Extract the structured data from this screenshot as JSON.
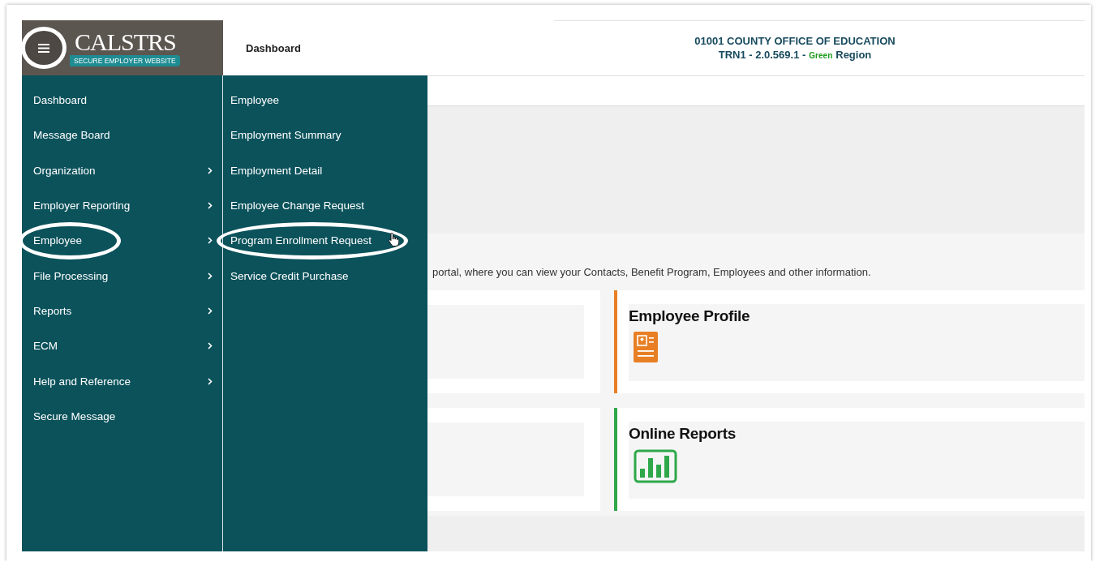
{
  "header": {
    "logo": {
      "name": "CALSTRS",
      "tagline": "SECURE EMPLOYER WEBSITE"
    },
    "menu_button": {
      "highlighted": true
    },
    "page_title": "Dashboard",
    "organization": "01001 COUNTY OFFICE OF EDUCATION",
    "environment": {
      "prefix": "TRN1 - 2.0.569.1 -",
      "region_color_name": "Green",
      "suffix": "Region"
    }
  },
  "menu": {
    "items": [
      {
        "label": "Dashboard",
        "has_submenu": false,
        "highlighted": false
      },
      {
        "label": "Message Board",
        "has_submenu": false,
        "highlighted": false
      },
      {
        "label": "Organization",
        "has_submenu": true,
        "highlighted": false
      },
      {
        "label": "Employer Reporting",
        "has_submenu": true,
        "highlighted": false
      },
      {
        "label": "Employee",
        "has_submenu": true,
        "highlighted": true
      },
      {
        "label": "File Processing",
        "has_submenu": true,
        "highlighted": false
      },
      {
        "label": "Reports",
        "has_submenu": true,
        "highlighted": false
      },
      {
        "label": "ECM",
        "has_submenu": true,
        "highlighted": false
      },
      {
        "label": "Help and Reference",
        "has_submenu": true,
        "highlighted": false
      },
      {
        "label": "Secure Message",
        "has_submenu": false,
        "highlighted": false
      }
    ],
    "submenu": [
      {
        "label": "Employee",
        "highlighted": false
      },
      {
        "label": "Employment Summary",
        "highlighted": false
      },
      {
        "label": "Employment Detail",
        "highlighted": false
      },
      {
        "label": "Employee Change Request",
        "highlighted": false
      },
      {
        "label": "Program Enrollment Request",
        "highlighted": true
      },
      {
        "label": "Service Credit Purchase",
        "highlighted": false
      }
    ]
  },
  "intro": "portal, where you can view your Contacts, Benefit Program, Employees and other information.",
  "cards": [
    {
      "title": "Employee Profile",
      "kind": "profile",
      "color": "#e87f24"
    },
    {
      "title": "Online Reports",
      "kind": "chart",
      "color": "#2ea84a"
    }
  ]
}
